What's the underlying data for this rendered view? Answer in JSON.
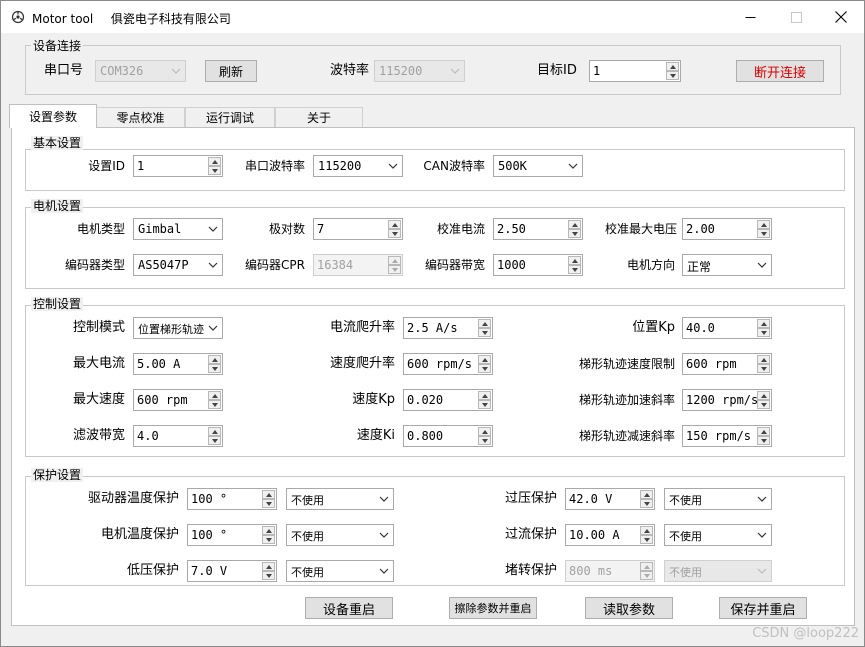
{
  "window": {
    "title": "Motor tool",
    "company": "俱瓷电子科技有限公司",
    "watermark": "CSDN @loop222"
  },
  "connection": {
    "title": "设备连接",
    "port_label": "串口号",
    "port_value": "COM326",
    "refresh_label": "刷新",
    "baud_label": "波特率",
    "baud_value": "115200",
    "target_id_label": "目标ID",
    "target_id_value": "1",
    "disconnect_label": "断开连接",
    "disconnect_color": "#e00000"
  },
  "tabs": [
    {
      "label": "设置参数",
      "active": true
    },
    {
      "label": "零点校准",
      "active": false
    },
    {
      "label": "运行调试",
      "active": false
    },
    {
      "label": "关于",
      "active": false
    }
  ],
  "basic": {
    "title": "基本设置",
    "id_label": "设置ID",
    "id_value": "1",
    "uart_baud_label": "串口波特率",
    "uart_baud_value": "115200",
    "can_baud_label": "CAN波特率",
    "can_baud_value": "500K"
  },
  "motor": {
    "title": "电机设置",
    "type_label": "电机类型",
    "type_value": "Gimbal",
    "pole_pairs_label": "极对数",
    "pole_pairs_value": "7",
    "cal_current_label": "校准电流",
    "cal_current_value": "2.50",
    "cal_max_voltage_label": "校准最大电压",
    "cal_max_voltage_value": "2.00",
    "encoder_type_label": "编码器类型",
    "encoder_type_value": "AS5047P",
    "encoder_cpr_label": "编码器CPR",
    "encoder_cpr_value": "16384",
    "encoder_bw_label": "编码器带宽",
    "encoder_bw_value": "1000",
    "direction_label": "电机方向",
    "direction_value": "正常"
  },
  "control": {
    "title": "控制设置",
    "mode_label": "控制模式",
    "mode_value": "位置梯形轨迹",
    "current_ramp_label": "电流爬升率",
    "current_ramp_value": "2.5 A/s",
    "pos_kp_label": "位置Kp",
    "pos_kp_value": "40.0",
    "max_current_label": "最大电流",
    "max_current_value": "5.00 A",
    "vel_ramp_label": "速度爬升率",
    "vel_ramp_value": "600 rpm/s",
    "traj_vel_limit_label": "梯形轨迹速度限制",
    "traj_vel_limit_value": "600 rpm",
    "max_vel_label": "最大速度",
    "max_vel_value": "600 rpm",
    "vel_kp_label": "速度Kp",
    "vel_kp_value": "0.020",
    "traj_accel_label": "梯形轨迹加速斜率",
    "traj_accel_value": "1200 rpm/s",
    "filter_bw_label": "滤波带宽",
    "filter_bw_value": "4.0",
    "vel_ki_label": "速度Ki",
    "vel_ki_value": "0.800",
    "traj_decel_label": "梯形轨迹减速斜率",
    "traj_decel_value": "150 rpm/s"
  },
  "protection": {
    "title": "保护设置",
    "driver_temp_label": "驱动器温度保护",
    "driver_temp_value": "100 °",
    "driver_temp_mode": "不使用",
    "motor_temp_label": "电机温度保护",
    "motor_temp_value": "100 °",
    "motor_temp_mode": "不使用",
    "under_voltage_label": "低压保护",
    "under_voltage_value": "7.0 V",
    "under_voltage_mode": "不使用",
    "over_voltage_label": "过压保护",
    "over_voltage_value": "42.0 V",
    "over_voltage_mode": "不使用",
    "over_current_label": "过流保护",
    "over_current_value": "10.00 A",
    "over_current_mode": "不使用",
    "stall_label": "堵转保护",
    "stall_value": "800 ms",
    "stall_mode": "不使用"
  },
  "actions": {
    "restart_label": "设备重启",
    "erase_restart_label": "擦除参数并重启",
    "read_label": "读取参数",
    "save_restart_label": "保存并重启"
  }
}
